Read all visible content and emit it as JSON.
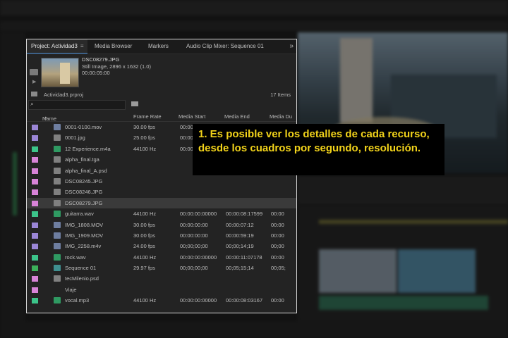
{
  "panel": {
    "tabs": [
      {
        "label": "Project: Actividad3",
        "menu": "≡",
        "active": true
      },
      {
        "label": "Media Browser"
      },
      {
        "label": "Markers"
      },
      {
        "label": "Audio Clip Mixer: Sequence 01"
      }
    ],
    "more_icon": "»",
    "preview": {
      "name": "DSC08279.JPG",
      "details": "Still Image, 2896 x 1632 (1.0)",
      "duration": "00:00:05:00"
    },
    "project_file": "Actividad3.prproj",
    "item_count": "17 Items",
    "columns": [
      "Name",
      "Frame Rate",
      "Media Start",
      "Media End",
      "Media Du"
    ],
    "rows": [
      {
        "color": "#9b86d6",
        "type": "video",
        "name": "0001-0100.mov",
        "fps": "30.00 fps",
        "start": "00:00",
        "end": "",
        "dur": ""
      },
      {
        "color": "#9b86d6",
        "type": "image",
        "name": "0001.jpg",
        "fps": "25.00 fps",
        "start": "00:00",
        "end": "",
        "dur": ""
      },
      {
        "color": "#3cc48a",
        "type": "audio",
        "name": "12 Experience.m4a",
        "fps": "44100 Hz",
        "start": "00:00",
        "end": "",
        "dur": ""
      },
      {
        "color": "#d883d8",
        "type": "image",
        "name": "alpha_final.tga",
        "fps": "",
        "start": "",
        "end": "",
        "dur": ""
      },
      {
        "color": "#d883d8",
        "type": "image",
        "name": "alpha_final_A.psd",
        "fps": "",
        "start": "",
        "end": "",
        "dur": ""
      },
      {
        "color": "#d883d8",
        "type": "image",
        "name": "DSC08245.JPG",
        "fps": "",
        "start": "",
        "end": "",
        "dur": ""
      },
      {
        "color": "#d883d8",
        "type": "image",
        "name": "DSC08246.JPG",
        "fps": "",
        "start": "",
        "end": "",
        "dur": ""
      },
      {
        "color": "#d883d8",
        "type": "image",
        "name": "DSC08279.JPG",
        "fps": "",
        "start": "",
        "end": "",
        "dur": "",
        "selected": true
      },
      {
        "color": "#3cc48a",
        "type": "audio",
        "name": "guitarra.wav",
        "fps": "44100 Hz",
        "start": "00:00:00:00000",
        "end": "00:00:08:17599",
        "dur": "00:00"
      },
      {
        "color": "#9b86d6",
        "type": "video",
        "name": "IMG_1808.MOV",
        "fps": "30.00 fps",
        "start": "00:00:00:00",
        "end": "00:00:07:12",
        "dur": "00:00"
      },
      {
        "color": "#9b86d6",
        "type": "video",
        "name": "IMG_1909.MOV",
        "fps": "30.00 fps",
        "start": "00:00:00:00",
        "end": "00:00:59:19",
        "dur": "00:00"
      },
      {
        "color": "#9b86d6",
        "type": "video",
        "name": "IMG_2258.m4v",
        "fps": "24.00 fps",
        "start": "00;00;00;00",
        "end": "00;00;14;19",
        "dur": "00;00"
      },
      {
        "color": "#3cc48a",
        "type": "audio",
        "name": "rock.wav",
        "fps": "44100 Hz",
        "start": "00:00:00:00000",
        "end": "00:00:11:07178",
        "dur": "00:00"
      },
      {
        "color": "#3cb05a",
        "type": "seq",
        "name": "Sequence 01",
        "fps": "29.97 fps",
        "start": "00;00;00;00",
        "end": "00;05;15;14",
        "dur": "00;05;"
      },
      {
        "color": "#d883d8",
        "type": "image",
        "name": "tecMilenio.psd",
        "fps": "",
        "start": "",
        "end": "",
        "dur": ""
      },
      {
        "color": "#d883d8",
        "type": "none",
        "name": "Viaje",
        "fps": "",
        "start": "",
        "end": "",
        "dur": ""
      },
      {
        "color": "#3cc48a",
        "type": "audio",
        "name": "vocal.mp3",
        "fps": "44100 Hz",
        "start": "00:00:00:00000",
        "end": "00:00:08:03167",
        "dur": "00:00"
      }
    ]
  },
  "callout": {
    "text": "1. Es posible ver los detalles de cada recurso, desde los cuadros por segundo, resolución.",
    "color": "#f2d31a"
  }
}
